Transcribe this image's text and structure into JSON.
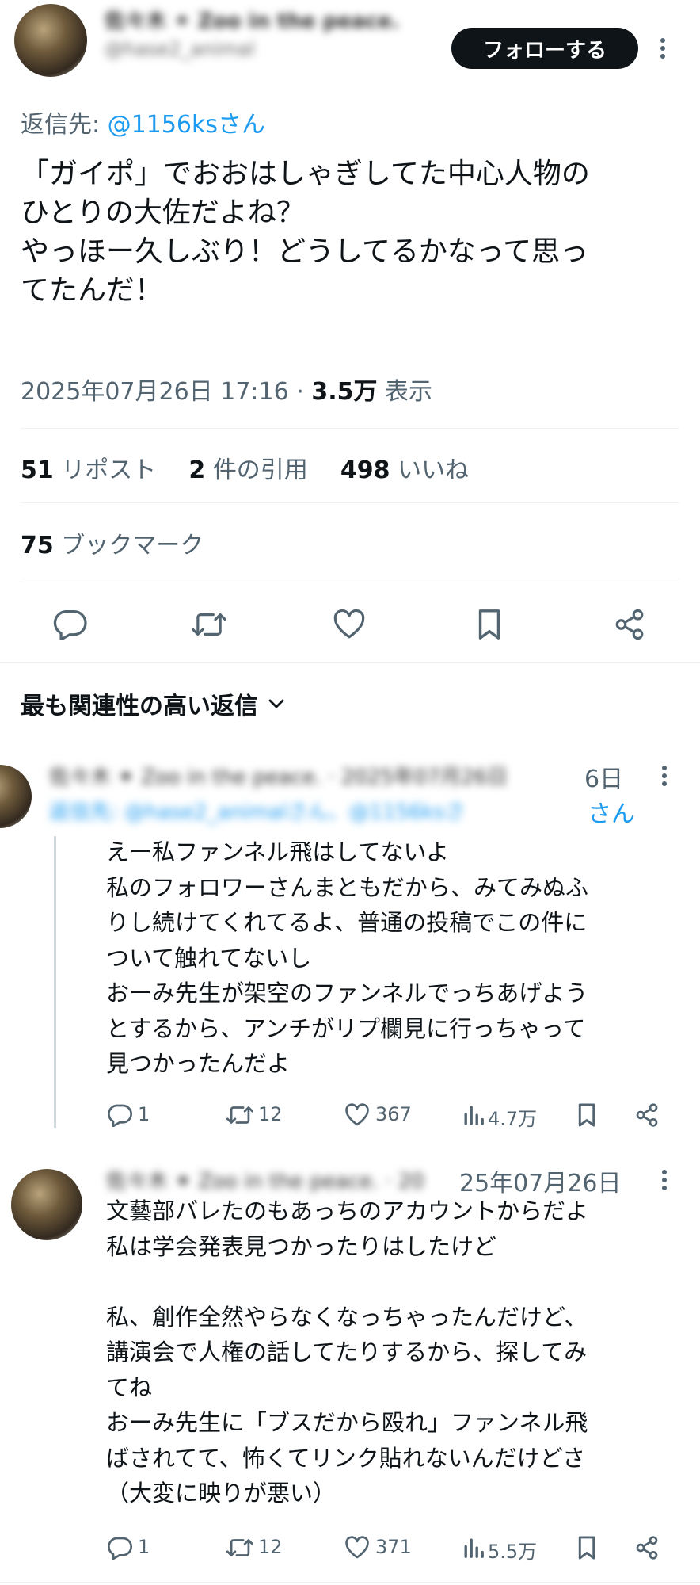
{
  "main_tweet": {
    "author_name": "佐々木 ✦ Zoo in the peace.",
    "author_handle": "@hase2_animal",
    "follow_label": "フォローする",
    "reply_to_prefix": "返信先:",
    "reply_to_handle": "@1156ksさん",
    "text": "「ガイポ」でおおはしゃぎしてた中心人物の\nひとりの大佐だよね？\nやっほー久しぶり！どうしてるかなって思っ\nてたんだ！",
    "timestamp": "2025年07月26日 17:16",
    "separator": "·",
    "views_count": "3.5万",
    "views_label": "表示"
  },
  "stats": {
    "reposts_count": "51",
    "reposts_label": "リポスト",
    "quotes_count": "2",
    "quotes_label": "件の引用",
    "likes_count": "498",
    "likes_label": "いいね",
    "bookmarks_count": "75",
    "bookmarks_label": "ブックマーク"
  },
  "sort": {
    "label": "最も関連性の高い返信"
  },
  "replies": [
    {
      "author_blurred": "佐々木 ✦ Zoo in the peace. · 2025年07月26日",
      "date_visible": "6日",
      "reply_to_blurred": "返信先: @hase2_animalさん、@1156ksさ",
      "reply_to_tail": "さん",
      "text": "えー私ファンネル飛はしてないよ\n私のフォロワーさんまともだから、みてみぬふ\nりし続けてくれてるよ、普通の投稿でこの件に\nついて触れてないし\nおーみ先生が架空のファンネルでっちあげよう\nとするから、アンチがリプ欄見に行っちゃって\n見つかったんだよ",
      "replies": "1",
      "reposts": "12",
      "likes": "367",
      "views": "4.7万"
    },
    {
      "author_blurred": "佐々木 ✦ Zoo in the peace. · 20",
      "date_visible": "25年07月26日",
      "text": "文藝部バレたのもあっちのアカウントからだよ\n私は学会発表見つかったりはしたけど\n\n私、創作全然やらなくなっちゃったんだけど、\n講演会で人権の話してたりするから、探してみ\nてね\nおーみ先生に「ブスだから殴れ」ファンネル飛\nばされてて、怖くてリンク貼れないんだけどさ\n（大変に映りが悪い）",
      "replies": "1",
      "reposts": "12",
      "likes": "371",
      "views": "5.5万"
    }
  ],
  "icons": {
    "reply": "reply-icon",
    "repost": "repost-icon",
    "like": "heart-icon",
    "bookmark": "bookmark-icon",
    "share": "share-icon",
    "views": "views-icon",
    "more": "more-icon",
    "chevron": "chevron-down-icon"
  }
}
